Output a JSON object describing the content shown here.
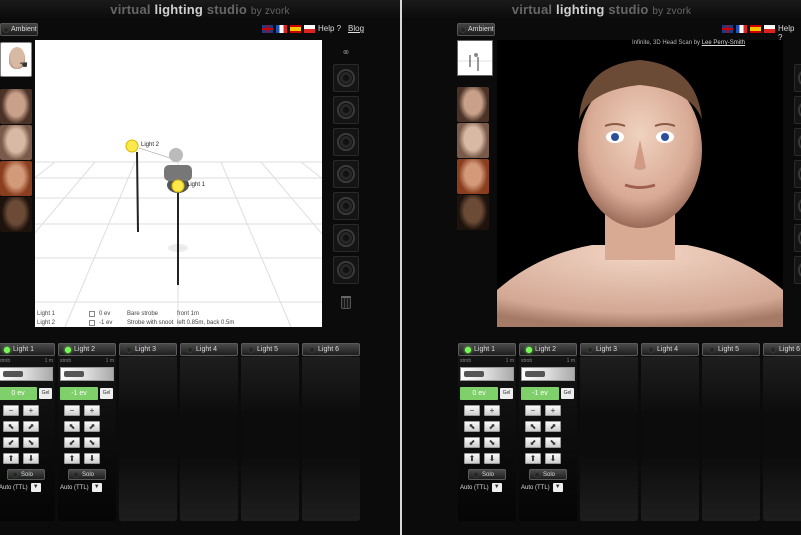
{
  "title": {
    "part1": "virtual",
    "part2": "lighting",
    "part3": "studio",
    "part4": "by zvork"
  },
  "topbar": {
    "ambient_label": "Ambient",
    "help_label": "Help ?",
    "blog_label": "Blog"
  },
  "scene": {
    "light_labels": [
      "Light 2",
      "Light 1"
    ],
    "legend": [
      {
        "name": "Light 1",
        "ev": "0 ev",
        "type": "Bare strobe",
        "position": "front 1m"
      },
      {
        "name": "Light 2",
        "ev": "-1 ev",
        "type": "Strobe with snoot",
        "position": "left 0.85m, back 0.5m"
      }
    ]
  },
  "right_panel": {
    "caption_text": "Infinite, 3D Head Scan by",
    "caption_author": "Lee Perry-Smith"
  },
  "lights": [
    {
      "label": "Light 1",
      "on": true,
      "strobe": "strob",
      "distance": "1 m",
      "ev": "0 ev",
      "cel": "Gel",
      "mode": "Auto (TTL)"
    },
    {
      "label": "Light 2",
      "on": true,
      "strobe": "strob",
      "distance": "1 m",
      "ev": "-1 ev",
      "cel": "Gel",
      "mode": "Auto (TTL)"
    },
    {
      "label": "Light 3",
      "on": false
    },
    {
      "label": "Light 4",
      "on": false
    },
    {
      "label": "Light 5",
      "on": false
    },
    {
      "label": "Light 6",
      "on": false
    }
  ],
  "controls": {
    "minus": "−",
    "plus": "+",
    "solo": "Solo",
    "dropdown": "▼"
  },
  "colors": {
    "ev_green": "#7fd06b",
    "led_on": "#6cff4a"
  },
  "icons": [
    "link-icon",
    "aperture-icon",
    "trash-icon",
    "arrow-icon",
    "flag-icon"
  ]
}
